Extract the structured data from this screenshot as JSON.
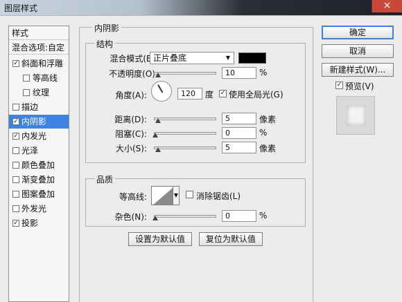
{
  "window": {
    "title": "图层样式",
    "close_glyph": "×"
  },
  "sidebar": {
    "header": "样式",
    "blend_options": "混合选项:自定",
    "items": [
      {
        "label": "斜面和浮雕",
        "checked": true
      },
      {
        "label": "等高线",
        "checked": false
      },
      {
        "label": "纹理",
        "checked": false
      },
      {
        "label": "描边",
        "checked": false
      },
      {
        "label": "内阴影",
        "checked": true,
        "selected": true
      },
      {
        "label": "内发光",
        "checked": true
      },
      {
        "label": "光泽",
        "checked": false
      },
      {
        "label": "颜色叠加",
        "checked": false
      },
      {
        "label": "渐变叠加",
        "checked": false
      },
      {
        "label": "图案叠加",
        "checked": false
      },
      {
        "label": "外发光",
        "checked": false
      },
      {
        "label": "投影",
        "checked": true
      }
    ],
    "check_glyph": "✓"
  },
  "inner_shadow": {
    "section_title": "内阴影",
    "structure": {
      "title": "结构",
      "blend_mode_label": "混合模式(B):",
      "blend_mode_value": "正片叠底",
      "shadow_color": "#000000",
      "opacity_label": "不透明度(O):",
      "opacity_value": "10",
      "opacity_unit": "%",
      "angle_label": "角度(A):",
      "angle_value": "120",
      "angle_unit": "度",
      "global_light_label": "使用全局光(G)",
      "global_light_checked": true,
      "distance_label": "距离(D):",
      "distance_value": "5",
      "distance_unit": "像素",
      "choke_label": "阻塞(C):",
      "choke_value": "0",
      "choke_unit": "%",
      "size_label": "大小(S):",
      "size_value": "5",
      "size_unit": "像素"
    },
    "quality": {
      "title": "品质",
      "contour_label": "等高线:",
      "anti_alias_label": "消除锯齿(L)",
      "anti_alias_checked": false,
      "noise_label": "杂色(N):",
      "noise_value": "0",
      "noise_unit": "%"
    },
    "make_default_label": "设置为默认值",
    "reset_default_label": "复位为默认值"
  },
  "actions": {
    "ok_label": "确定",
    "cancel_label": "取消",
    "new_style_label": "新建样式(W)...",
    "preview_label": "预览(V)",
    "preview_checked": true
  },
  "caret_glyph": "▼",
  "colors": {
    "accent": "#3d82e5",
    "close": "#c9483a"
  }
}
